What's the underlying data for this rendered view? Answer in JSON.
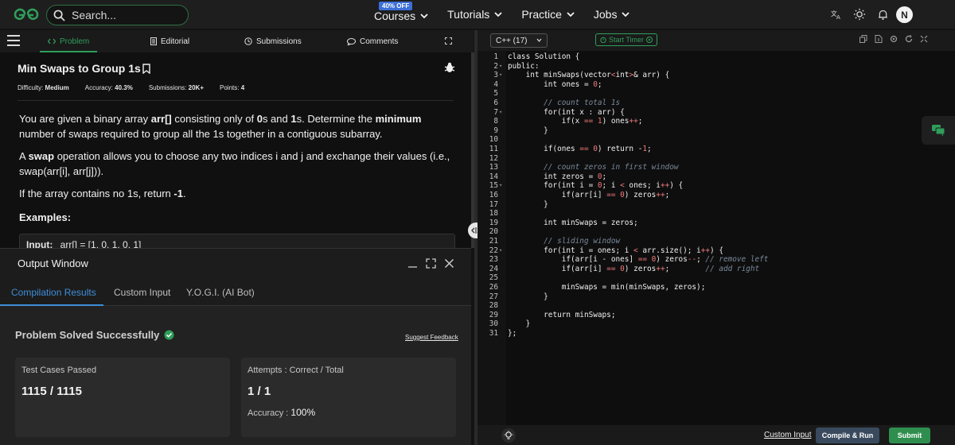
{
  "nav": {
    "search_placeholder": "Search...",
    "promo_badge": "40% OFF",
    "links": [
      "Courses",
      "Tutorials",
      "Practice",
      "Jobs"
    ],
    "avatar_initial": "N"
  },
  "left_tabs": [
    "Problem",
    "Editorial",
    "Submissions",
    "Comments"
  ],
  "problem": {
    "title": "Min Swaps to Group 1s",
    "difficulty_label": "Difficulty:",
    "difficulty": "Medium",
    "accuracy_label": "Accuracy:",
    "accuracy": "40.3%",
    "submissions_label": "Submissions:",
    "submissions": "20K+",
    "points_label": "Points:",
    "points": "4",
    "p1_a": "You are given a binary array ",
    "p1_b": "arr[]",
    "p1_c": " consisting only of ",
    "p1_d": "0",
    "p1_e": "s and ",
    "p1_f": "1",
    "p1_g": "s. Determine the ",
    "p1_h": "minimum",
    "p1_i": " number of swaps required to group all the 1s together in a contiguous subarray.",
    "p2_a": "A ",
    "p2_b": "swap",
    "p2_c": " operation allows you to choose any two indices i and j and exchange their values (i.e., swap(arr[i], arr[j])).",
    "p3_a": "If the array contains no 1s, return ",
    "p3_b": "-1",
    "p3_c": ".",
    "examples_heading": "Examples:",
    "example_input_label": "Input:",
    "example_input_value": "arr[] = [1, 0, 1, 0, 1]"
  },
  "output": {
    "title": "Output Window",
    "tabs": [
      "Compilation Results",
      "Custom Input",
      "Y.O.G.I. (AI Bot)"
    ],
    "status": "Problem Solved Successfully",
    "feedback_link": "Suggest Feedback",
    "tests_label": "Test Cases Passed",
    "tests_value": "1115 / 1115",
    "attempts_label": "Attempts : Correct / Total",
    "attempts_value": "1 / 1",
    "accuracy_label": "Accuracy :",
    "accuracy_value": "100%"
  },
  "editor": {
    "language": "C++ (17)",
    "timer_label": "Start Timer",
    "custom_input_link": "Custom Input",
    "compile_button": "Compile & Run",
    "submit_button": "Submit",
    "lines": [
      "class Solution {",
      "public:",
      "    int minSwaps(vector<int>& arr) {",
      "        int ones = 0;",
      "",
      "        // count total 1s",
      "        for(int x : arr) {",
      "            if(x == 1) ones++;",
      "        }",
      "",
      "        if(ones == 0) return -1;",
      "",
      "        // count zeros in first window",
      "        int zeros = 0;",
      "        for(int i = 0; i < ones; i++) {",
      "            if(arr[i] == 0) zeros++;",
      "        }",
      "",
      "        int minSwaps = zeros;",
      "",
      "        // sliding window",
      "        for(int i = ones; i < arr.size(); i++) {",
      "            if(arr[i - ones] == 0) zeros--; // remove left",
      "            if(arr[i] == 0) zeros++;        // add right",
      "",
      "            minSwaps = min(minSwaps, zeros);",
      "        }",
      "",
      "        return minSwaps;",
      "    }",
      "};"
    ]
  },
  "colors": {
    "accent_green": "#2f9e5a",
    "accent_blue": "#3d8ed9"
  }
}
